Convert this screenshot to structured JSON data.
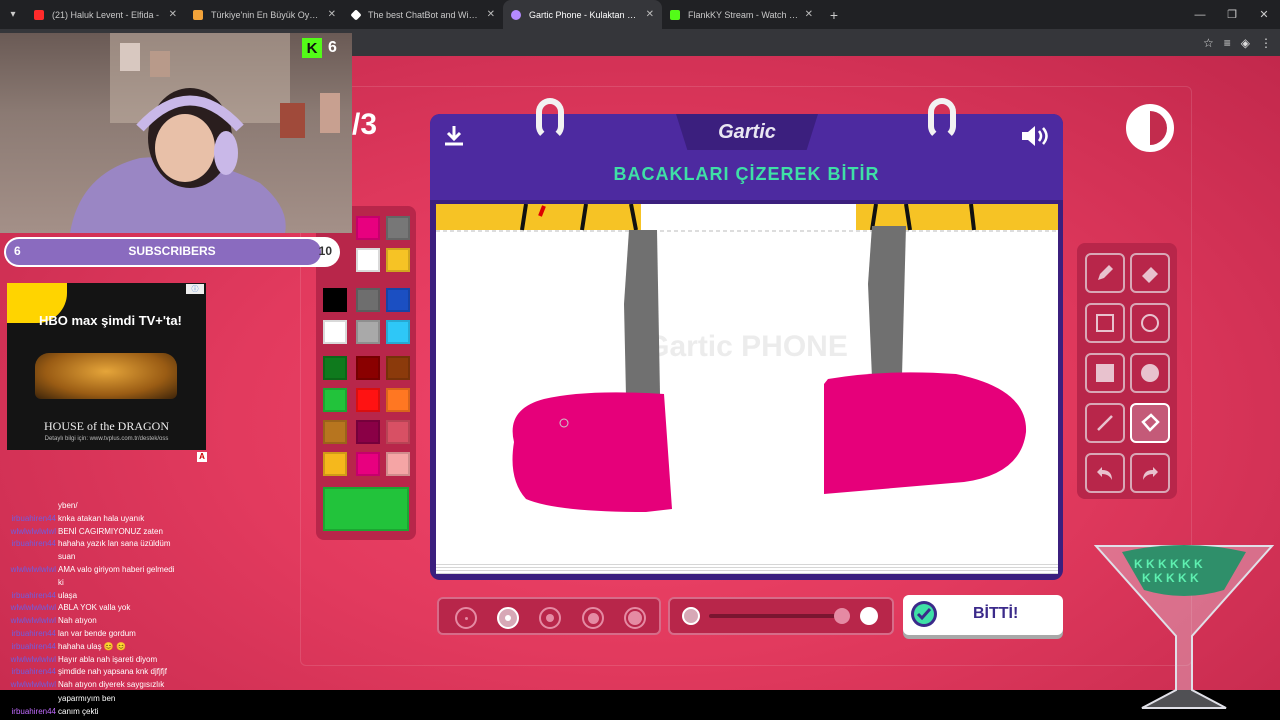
{
  "browser": {
    "tabs": [
      {
        "title": "(21) Haluk Levent - Elfida -",
        "fav": "#ff2b2b"
      },
      {
        "title": "Türkiye'nin En Büyük Oyuncu D",
        "fav": "#f2a33a"
      },
      {
        "title": "The best ChatBot and Widgets",
        "fav": "#ffffff"
      },
      {
        "title": "Gartic Phone - Kulaktan Kulağa",
        "fav": "#b58bff"
      },
      {
        "title": "FlankKY Stream - Watch Live on",
        "fav": "#53fc18"
      }
    ],
    "new_tab": "+",
    "min": "—",
    "max": "❐",
    "close": "✕"
  },
  "stream": {
    "viewer_count": "6",
    "kick_logo": "K",
    "sub_goal": {
      "current": "6",
      "label": "SUBSCRIBERS",
      "target": "10",
      "progress": 0.95
    },
    "ad": {
      "brand": "HBO max şimdi TV+'ta!",
      "title": "HOUSE of the DRAGON",
      "subtitle": "Detaylı bilgi için: www.tvplus.com.tr/destek/oss",
      "badge": "A"
    },
    "chat": [
      {
        "user": "",
        "msg": "yben/"
      },
      {
        "user": "irbuahiren44",
        "msg": "knka atakan hala uyanık"
      },
      {
        "user": "wlwlwlwlwlwl",
        "msg": "BENİ CAGIRMIYONUZ zaten"
      },
      {
        "user": "irbuahiren44",
        "msg": "hahaha yazık lan sana üzüldüm"
      },
      {
        "user": "",
        "msg": "suan"
      },
      {
        "user": "wlwlwlwlwlwl",
        "msg": "AMA valo giriyom haberi gelmedi"
      },
      {
        "user": "",
        "msg": "ki"
      },
      {
        "user": "irbuahiren44",
        "msg": "ulaşa"
      },
      {
        "user": "wlwlwlwlwlwl",
        "msg": "ABLA YOK valla yok"
      },
      {
        "user": "wlwlwlwlwlwl",
        "msg": "Nah atıyon"
      },
      {
        "user": "irbuahiren44",
        "msg": "lan var bende gordum"
      },
      {
        "user": "irbuahiren44",
        "msg": "hahaha ulaş 😊 😊"
      },
      {
        "user": "wlwlwlwlwlwl",
        "msg": "Hayır abla nah işareti diyom"
      },
      {
        "user": "irbuahiren44",
        "msg": "şimdide nah yapsana knk djfjfjf"
      },
      {
        "user": "wlwlwlwlwlwl",
        "msg": "Nah atıyon diyerek saygısızlık"
      }
    ],
    "chat_bottom": [
      {
        "user": "",
        "msg": "yaparmıyım ben"
      },
      {
        "user": "irbuahiren44",
        "msg": "canım çekti"
      }
    ]
  },
  "game": {
    "round": "/3",
    "logo": "Gartic",
    "instruction": "BACAKLARI ÇİZEREK BİTİR",
    "watermark": "Gartic PHONE",
    "done_label": "BİTTİ!",
    "palette": [
      "#e8007f",
      "#777777",
      "#ffffff",
      "#f6c325",
      "#000000",
      "#6e6e6e",
      "#1b4fc2",
      "#ffffff",
      "#a9a9a9",
      "#2ec7f7",
      "#0f7a1d",
      "#8a0000",
      "#8b3a0b",
      "#22c33b",
      "#ff1212",
      "#ff7722",
      "#b7751f",
      "#8a0046",
      "#d85064",
      "#f5b81c",
      "#e8007f",
      "#f5a5a5"
    ],
    "selected_color": "#22c33b",
    "tools": [
      "pencil-icon",
      "eraser-icon",
      "rectangle-outline-icon",
      "ellipse-outline-icon",
      "rectangle-fill-icon",
      "ellipse-fill-icon",
      "line-icon",
      "bucket-icon",
      "undo-icon",
      "redo-icon"
    ],
    "selected_tool": "bucket-icon",
    "brush_sizes": 5,
    "selected_size": 2,
    "opacity": 0.85
  }
}
